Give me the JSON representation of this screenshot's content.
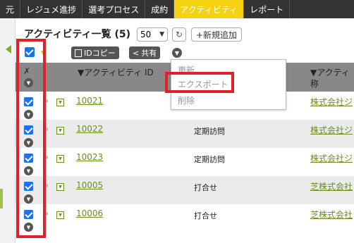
{
  "nav": {
    "items": [
      "元",
      "レジュメ進捗",
      "選考プロセス",
      "成約",
      "アクティビティ",
      "レポート"
    ],
    "active_index": 4,
    "active_color": "#f5d312"
  },
  "list": {
    "title": "アクティビティ一覧 (5)",
    "per_page": "50",
    "new_label": "+新規追加"
  },
  "toolbar": {
    "id_copy": "IDコピー",
    "share": "共有"
  },
  "table": {
    "headers": [
      "▼アクティビティ ID",
      "▼アクティ",
      "称"
    ],
    "rows": [
      {
        "id": "10021",
        "type": "",
        "company": "株式会社ジ"
      },
      {
        "id": "10022",
        "type": "定期訪問",
        "company": "株式会社ジ"
      },
      {
        "id": "10023",
        "type": "定期訪問",
        "company": "株式会社ジ"
      },
      {
        "id": "10005",
        "type": "打合せ",
        "company": "芝株式会社"
      },
      {
        "id": "10006",
        "type": "打合せ",
        "company": "芝株式会社"
      }
    ]
  },
  "menu": {
    "items": [
      "更新",
      "エクスポート",
      "削除"
    ]
  },
  "colors": {
    "highlight": "#e0202a",
    "checkbox": "#1a73e8",
    "link": "#6b8e23"
  }
}
